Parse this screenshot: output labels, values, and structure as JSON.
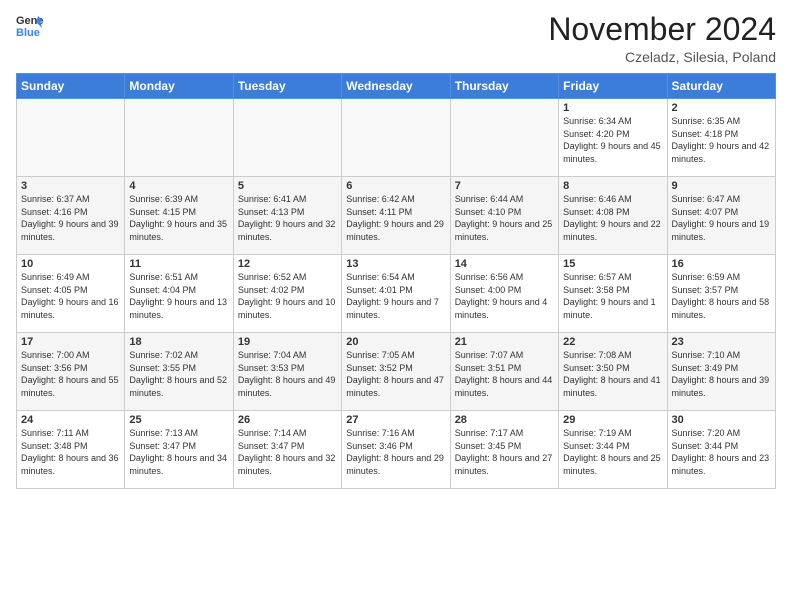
{
  "header": {
    "logo_line1": "General",
    "logo_line2": "Blue",
    "month_title": "November 2024",
    "location": "Czeladz, Silesia, Poland"
  },
  "weekdays": [
    "Sunday",
    "Monday",
    "Tuesday",
    "Wednesday",
    "Thursday",
    "Friday",
    "Saturday"
  ],
  "weeks": [
    [
      {
        "day": "",
        "info": ""
      },
      {
        "day": "",
        "info": ""
      },
      {
        "day": "",
        "info": ""
      },
      {
        "day": "",
        "info": ""
      },
      {
        "day": "",
        "info": ""
      },
      {
        "day": "1",
        "info": "Sunrise: 6:34 AM\nSunset: 4:20 PM\nDaylight: 9 hours and 45 minutes."
      },
      {
        "day": "2",
        "info": "Sunrise: 6:35 AM\nSunset: 4:18 PM\nDaylight: 9 hours and 42 minutes."
      }
    ],
    [
      {
        "day": "3",
        "info": "Sunrise: 6:37 AM\nSunset: 4:16 PM\nDaylight: 9 hours and 39 minutes."
      },
      {
        "day": "4",
        "info": "Sunrise: 6:39 AM\nSunset: 4:15 PM\nDaylight: 9 hours and 35 minutes."
      },
      {
        "day": "5",
        "info": "Sunrise: 6:41 AM\nSunset: 4:13 PM\nDaylight: 9 hours and 32 minutes."
      },
      {
        "day": "6",
        "info": "Sunrise: 6:42 AM\nSunset: 4:11 PM\nDaylight: 9 hours and 29 minutes."
      },
      {
        "day": "7",
        "info": "Sunrise: 6:44 AM\nSunset: 4:10 PM\nDaylight: 9 hours and 25 minutes."
      },
      {
        "day": "8",
        "info": "Sunrise: 6:46 AM\nSunset: 4:08 PM\nDaylight: 9 hours and 22 minutes."
      },
      {
        "day": "9",
        "info": "Sunrise: 6:47 AM\nSunset: 4:07 PM\nDaylight: 9 hours and 19 minutes."
      }
    ],
    [
      {
        "day": "10",
        "info": "Sunrise: 6:49 AM\nSunset: 4:05 PM\nDaylight: 9 hours and 16 minutes."
      },
      {
        "day": "11",
        "info": "Sunrise: 6:51 AM\nSunset: 4:04 PM\nDaylight: 9 hours and 13 minutes."
      },
      {
        "day": "12",
        "info": "Sunrise: 6:52 AM\nSunset: 4:02 PM\nDaylight: 9 hours and 10 minutes."
      },
      {
        "day": "13",
        "info": "Sunrise: 6:54 AM\nSunset: 4:01 PM\nDaylight: 9 hours and 7 minutes."
      },
      {
        "day": "14",
        "info": "Sunrise: 6:56 AM\nSunset: 4:00 PM\nDaylight: 9 hours and 4 minutes."
      },
      {
        "day": "15",
        "info": "Sunrise: 6:57 AM\nSunset: 3:58 PM\nDaylight: 9 hours and 1 minute."
      },
      {
        "day": "16",
        "info": "Sunrise: 6:59 AM\nSunset: 3:57 PM\nDaylight: 8 hours and 58 minutes."
      }
    ],
    [
      {
        "day": "17",
        "info": "Sunrise: 7:00 AM\nSunset: 3:56 PM\nDaylight: 8 hours and 55 minutes."
      },
      {
        "day": "18",
        "info": "Sunrise: 7:02 AM\nSunset: 3:55 PM\nDaylight: 8 hours and 52 minutes."
      },
      {
        "day": "19",
        "info": "Sunrise: 7:04 AM\nSunset: 3:53 PM\nDaylight: 8 hours and 49 minutes."
      },
      {
        "day": "20",
        "info": "Sunrise: 7:05 AM\nSunset: 3:52 PM\nDaylight: 8 hours and 47 minutes."
      },
      {
        "day": "21",
        "info": "Sunrise: 7:07 AM\nSunset: 3:51 PM\nDaylight: 8 hours and 44 minutes."
      },
      {
        "day": "22",
        "info": "Sunrise: 7:08 AM\nSunset: 3:50 PM\nDaylight: 8 hours and 41 minutes."
      },
      {
        "day": "23",
        "info": "Sunrise: 7:10 AM\nSunset: 3:49 PM\nDaylight: 8 hours and 39 minutes."
      }
    ],
    [
      {
        "day": "24",
        "info": "Sunrise: 7:11 AM\nSunset: 3:48 PM\nDaylight: 8 hours and 36 minutes."
      },
      {
        "day": "25",
        "info": "Sunrise: 7:13 AM\nSunset: 3:47 PM\nDaylight: 8 hours and 34 minutes."
      },
      {
        "day": "26",
        "info": "Sunrise: 7:14 AM\nSunset: 3:47 PM\nDaylight: 8 hours and 32 minutes."
      },
      {
        "day": "27",
        "info": "Sunrise: 7:16 AM\nSunset: 3:46 PM\nDaylight: 8 hours and 29 minutes."
      },
      {
        "day": "28",
        "info": "Sunrise: 7:17 AM\nSunset: 3:45 PM\nDaylight: 8 hours and 27 minutes."
      },
      {
        "day": "29",
        "info": "Sunrise: 7:19 AM\nSunset: 3:44 PM\nDaylight: 8 hours and 25 minutes."
      },
      {
        "day": "30",
        "info": "Sunrise: 7:20 AM\nSunset: 3:44 PM\nDaylight: 8 hours and 23 minutes."
      }
    ]
  ]
}
